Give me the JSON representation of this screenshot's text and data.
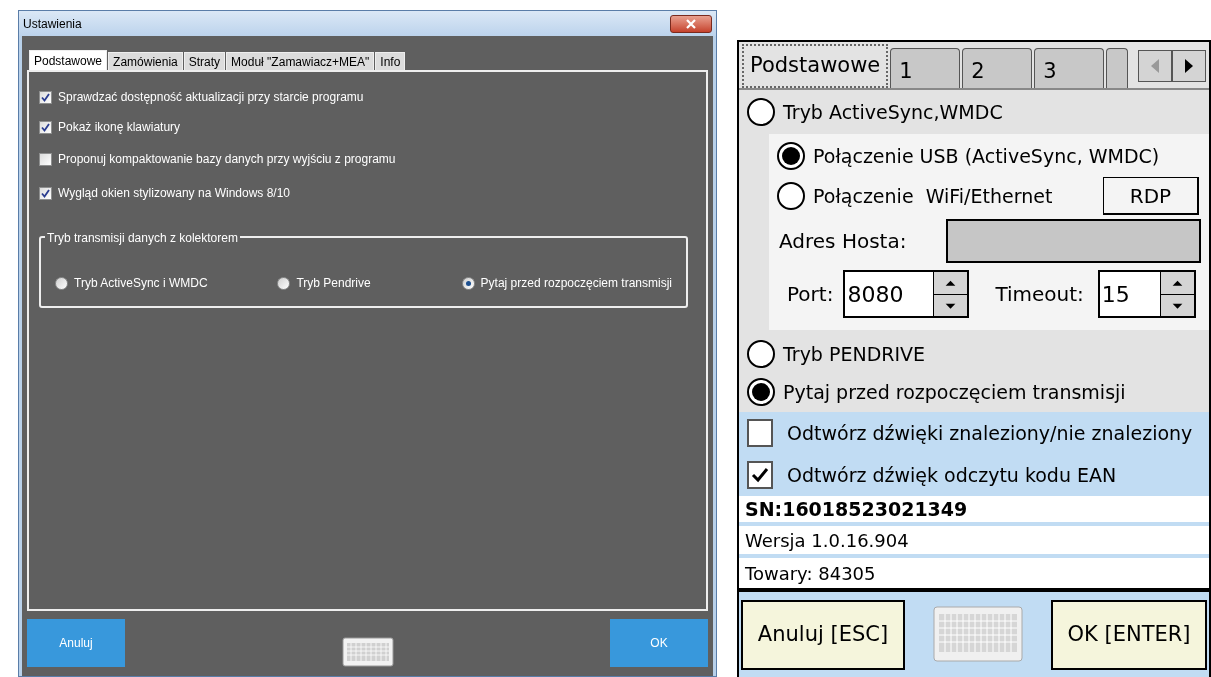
{
  "desktop_dialog": {
    "title": "Ustawienia",
    "tabs": [
      {
        "label": "Podstawowe",
        "selected": true
      },
      {
        "label": "Zamówienia",
        "selected": false
      },
      {
        "label": "Straty",
        "selected": false
      },
      {
        "label": "Moduł \"Zamawiacz+MEA\"",
        "selected": false
      },
      {
        "label": "Info",
        "selected": false
      }
    ],
    "checkboxes": [
      {
        "label": "Sprawdzać dostępność aktualizacji przy starcie programu",
        "checked": true
      },
      {
        "label": "Pokaż ikonę klawiatury",
        "checked": true
      },
      {
        "label": "Proponuj kompaktowanie bazy danych przy wyjściu z programu",
        "checked": false
      },
      {
        "label": "Wygląd okien stylizowany na Windows 8/10",
        "checked": true
      }
    ],
    "transfer_group": {
      "title": "Tryb transmisji danych z kolektorem",
      "options": [
        {
          "label": "Tryb ActiveSync i WMDC",
          "selected": false
        },
        {
          "label": "Tryb Pendrive",
          "selected": false
        },
        {
          "label": "Pytaj przed rozpoczęciem transmisji",
          "selected": true
        }
      ]
    },
    "cancel_button": "Anuluj",
    "ok_button": "OK"
  },
  "mobile_dialog": {
    "tabs": [
      {
        "label": "Podstawowe",
        "selected": true
      },
      {
        "label": "1",
        "selected": false
      },
      {
        "label": "2",
        "selected": false
      },
      {
        "label": "3",
        "selected": false
      }
    ],
    "transfer_modes": [
      {
        "label": "Tryb ActiveSync,WMDC",
        "selected": false
      },
      {
        "label": "Tryb PENDRIVE",
        "selected": false
      },
      {
        "label": "Pytaj przed rozpoczęciem transmisji",
        "selected": true
      }
    ],
    "connection": {
      "options": [
        {
          "label": "Połączenie USB (ActiveSync, WMDC)",
          "selected": true
        },
        {
          "label": "Połączenie  WiFi/Ethernet",
          "selected": false
        }
      ],
      "rdp_button": "RDP",
      "host_label": "Adres Hosta:",
      "port_label": "Port:",
      "port": "8080",
      "timeout_label": "Timeout:",
      "timeout": "15"
    },
    "checkboxes": [
      {
        "label": "Odtwórz dźwięki znaleziony/nie znaleziony",
        "checked": false
      },
      {
        "label": "Odtwórz dźwięk odczytu kodu EAN",
        "checked": true
      }
    ],
    "serial": "SN:16018523021349",
    "version": "Wersja 1.0.16.904",
    "items_count": "Towary: 84305",
    "cancel_button": "Anuluj [ESC]",
    "ok_button": "OK [ENTER]"
  }
}
